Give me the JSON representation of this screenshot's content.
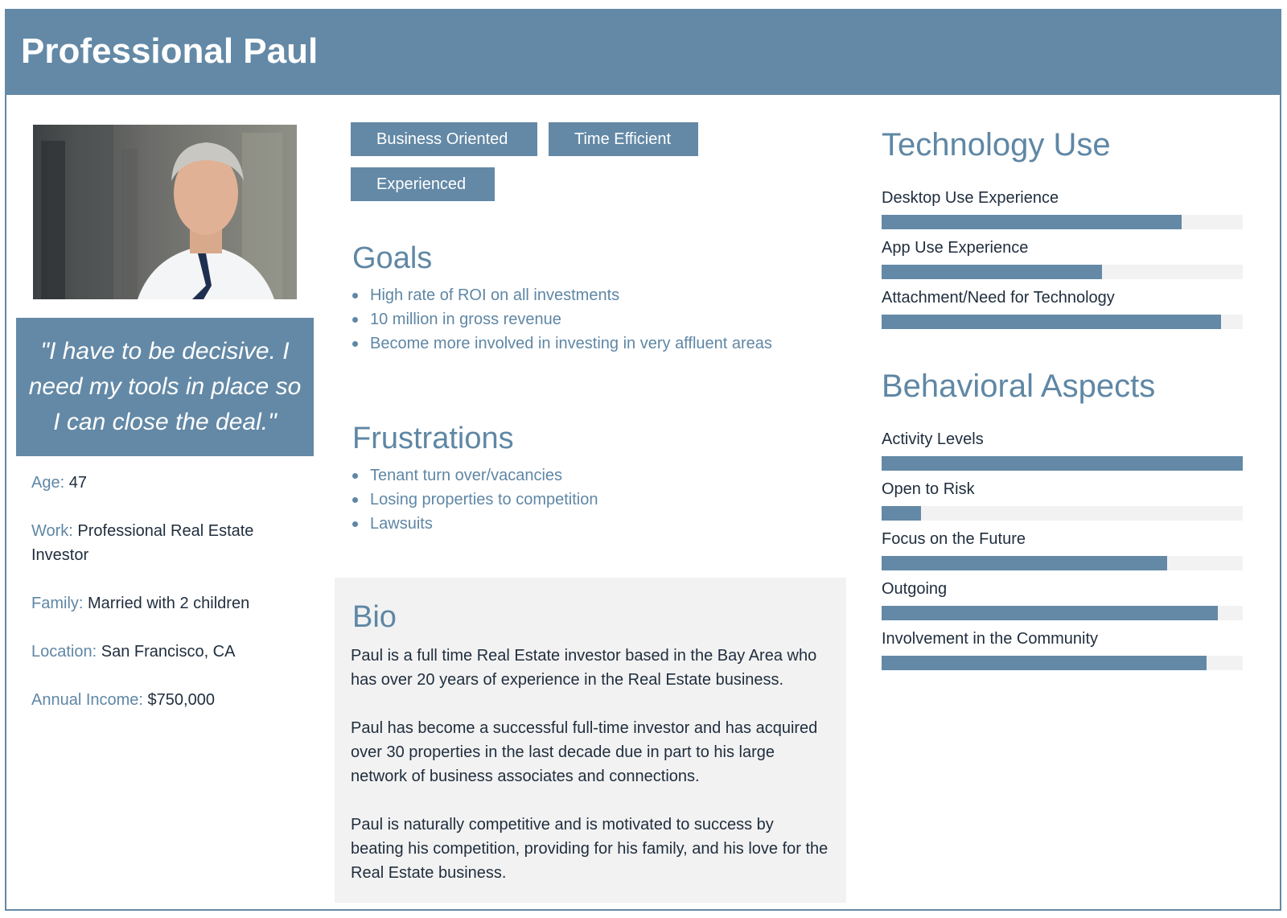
{
  "header": {
    "title": "Professional Paul"
  },
  "quote": "\"I have to be decisive. I need my tools in place so I can close the deal.\"",
  "facts": [
    {
      "key": "Age:",
      "value": "47"
    },
    {
      "key": "Work:",
      "value": "Professional Real Estate Investor"
    },
    {
      "key": "Family:",
      "value": "Married with 2 children"
    },
    {
      "key": "Location:",
      "value": "San Francisco, CA"
    },
    {
      "key": "Annual Income:",
      "value": "$750,000"
    }
  ],
  "tags": [
    "Business Oriented",
    "Time Efficient",
    "Experienced"
  ],
  "goals": {
    "title": "Goals",
    "items": [
      "High rate of ROI on all investments",
      "10 million in gross revenue",
      "Become more involved in investing in very affluent areas"
    ]
  },
  "frustrations": {
    "title": "Frustrations",
    "items": [
      "Tenant turn over/vacancies",
      "Losing properties to competition",
      "Lawsuits"
    ]
  },
  "bio": {
    "title": "Bio",
    "paragraphs": [
      "Paul is a full time Real Estate investor based in the Bay Area who has over 20 years of experience in the Real Estate business.",
      "Paul has become a successful full-time investor and has acquired over 30 properties in the last decade due in part to his large network of business associates and connections.",
      "Paul is naturally competitive and is motivated to success by beating his competition, providing for his family, and his love for the Real Estate business."
    ]
  },
  "technology": {
    "title": "Technology Use",
    "meters": [
      {
        "label": "Desktop Use Experience",
        "value": 0.83
      },
      {
        "label": "App Use Experience",
        "value": 0.61
      },
      {
        "label": "Attachment/Need for Technology",
        "value": 0.94
      }
    ]
  },
  "behavior": {
    "title": "Behavioral Aspects",
    "meters": [
      {
        "label": "Activity Levels",
        "value": 1.0
      },
      {
        "label": "Open to Risk",
        "value": 0.11
      },
      {
        "label": "Focus on the Future",
        "value": 0.79
      },
      {
        "label": "Outgoing",
        "value": 0.93
      },
      {
        "label": "Involvement in the Community",
        "value": 0.9
      }
    ]
  },
  "colors": {
    "accent": "#6389a6",
    "accent_text": "#5f87a5",
    "panel": "#f2f2f2"
  }
}
